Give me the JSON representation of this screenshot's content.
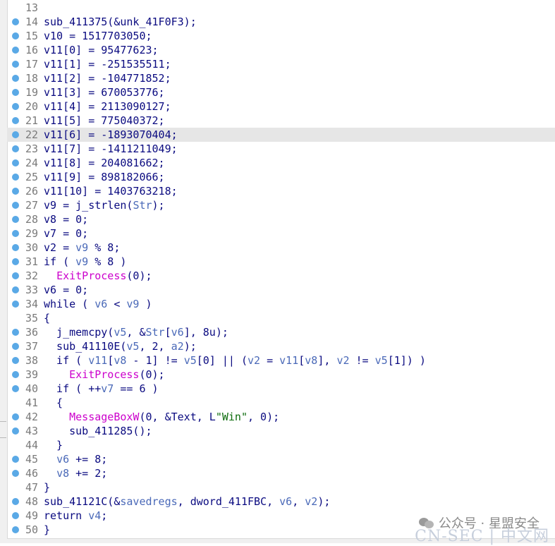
{
  "watermark": {
    "text": "公众号 · 星盟安全",
    "site": "CN-SEC | 中文网"
  },
  "highlighted_line": "22",
  "lines": [
    {
      "num": "13",
      "bp": false,
      "tokens": []
    },
    {
      "num": "14",
      "bp": true,
      "tokens": [
        {
          "t": "sub_411375(&unk_41F0F3);",
          "c": "kw"
        }
      ]
    },
    {
      "num": "15",
      "bp": true,
      "tokens": [
        {
          "t": "v10 = 1517703050;",
          "c": "kw"
        }
      ]
    },
    {
      "num": "16",
      "bp": true,
      "tokens": [
        {
          "t": "v11[0] = 95477623;",
          "c": "kw"
        }
      ]
    },
    {
      "num": "17",
      "bp": true,
      "tokens": [
        {
          "t": "v11[1] = -251535511;",
          "c": "kw"
        }
      ]
    },
    {
      "num": "18",
      "bp": true,
      "tokens": [
        {
          "t": "v11[2] = -104771852;",
          "c": "kw"
        }
      ]
    },
    {
      "num": "19",
      "bp": true,
      "tokens": [
        {
          "t": "v11[3] = 670053776;",
          "c": "kw"
        }
      ]
    },
    {
      "num": "20",
      "bp": true,
      "tokens": [
        {
          "t": "v11[4] = 2113090127;",
          "c": "kw"
        }
      ]
    },
    {
      "num": "21",
      "bp": true,
      "tokens": [
        {
          "t": "v11[5] = 775040372;",
          "c": "kw"
        }
      ]
    },
    {
      "num": "22",
      "bp": true,
      "tokens": [
        {
          "t": "v11[6] = -1893070404;",
          "c": "kw"
        }
      ]
    },
    {
      "num": "23",
      "bp": true,
      "tokens": [
        {
          "t": "v11[7] = -1411211049;",
          "c": "kw"
        }
      ]
    },
    {
      "num": "24",
      "bp": true,
      "tokens": [
        {
          "t": "v11[8] = 204081662;",
          "c": "kw"
        }
      ]
    },
    {
      "num": "25",
      "bp": true,
      "tokens": [
        {
          "t": "v11[9] = 898182066;",
          "c": "kw"
        }
      ]
    },
    {
      "num": "26",
      "bp": true,
      "tokens": [
        {
          "t": "v11[10] = 1403763218;",
          "c": "kw"
        }
      ]
    },
    {
      "num": "27",
      "bp": true,
      "tokens": [
        {
          "t": "v9 = j_strlen(",
          "c": "kw"
        },
        {
          "t": "Str",
          "c": "var"
        },
        {
          "t": ");",
          "c": "kw"
        }
      ]
    },
    {
      "num": "28",
      "bp": true,
      "tokens": [
        {
          "t": "v8 = 0;",
          "c": "kw"
        }
      ]
    },
    {
      "num": "29",
      "bp": true,
      "tokens": [
        {
          "t": "v7 = 0;",
          "c": "kw"
        }
      ]
    },
    {
      "num": "30",
      "bp": true,
      "tokens": [
        {
          "t": "v2 = ",
          "c": "kw"
        },
        {
          "t": "v9",
          "c": "var"
        },
        {
          "t": " % 8;",
          "c": "kw"
        }
      ]
    },
    {
      "num": "31",
      "bp": true,
      "tokens": [
        {
          "t": "if ( ",
          "c": "kw"
        },
        {
          "t": "v9",
          "c": "var"
        },
        {
          "t": " % 8 )",
          "c": "kw"
        }
      ]
    },
    {
      "num": "32",
      "bp": true,
      "tokens": [
        {
          "t": "  ",
          "c": "kw"
        },
        {
          "t": "ExitProcess",
          "c": "fn"
        },
        {
          "t": "(0);",
          "c": "kw"
        }
      ]
    },
    {
      "num": "33",
      "bp": true,
      "tokens": [
        {
          "t": "v6 = 0;",
          "c": "kw"
        }
      ]
    },
    {
      "num": "34",
      "bp": true,
      "tokens": [
        {
          "t": "while ( ",
          "c": "kw"
        },
        {
          "t": "v6",
          "c": "var"
        },
        {
          "t": " < ",
          "c": "kw"
        },
        {
          "t": "v9",
          "c": "var"
        },
        {
          "t": " )",
          "c": "kw"
        }
      ]
    },
    {
      "num": "35",
      "bp": false,
      "tokens": [
        {
          "t": "{",
          "c": "kw"
        }
      ]
    },
    {
      "num": "36",
      "bp": true,
      "tokens": [
        {
          "t": "  j_memcpy(",
          "c": "kw"
        },
        {
          "t": "v5",
          "c": "var"
        },
        {
          "t": ", &",
          "c": "kw"
        },
        {
          "t": "Str",
          "c": "var"
        },
        {
          "t": "[",
          "c": "kw"
        },
        {
          "t": "v6",
          "c": "var"
        },
        {
          "t": "], 8u);",
          "c": "kw"
        }
      ]
    },
    {
      "num": "37",
      "bp": true,
      "tokens": [
        {
          "t": "  sub_41110E(",
          "c": "kw"
        },
        {
          "t": "v5",
          "c": "var"
        },
        {
          "t": ", 2, ",
          "c": "kw"
        },
        {
          "t": "a2",
          "c": "var"
        },
        {
          "t": ");",
          "c": "kw"
        }
      ]
    },
    {
      "num": "38",
      "bp": true,
      "tokens": [
        {
          "t": "  if ( ",
          "c": "kw"
        },
        {
          "t": "v11",
          "c": "var"
        },
        {
          "t": "[",
          "c": "kw"
        },
        {
          "t": "v8",
          "c": "var"
        },
        {
          "t": " - 1] != ",
          "c": "kw"
        },
        {
          "t": "v5",
          "c": "var"
        },
        {
          "t": "[0] || (",
          "c": "kw"
        },
        {
          "t": "v2",
          "c": "var"
        },
        {
          "t": " = ",
          "c": "kw"
        },
        {
          "t": "v11",
          "c": "var"
        },
        {
          "t": "[",
          "c": "kw"
        },
        {
          "t": "v8",
          "c": "var"
        },
        {
          "t": "], ",
          "c": "kw"
        },
        {
          "t": "v2",
          "c": "var"
        },
        {
          "t": " != ",
          "c": "kw"
        },
        {
          "t": "v5",
          "c": "var"
        },
        {
          "t": "[1]) )",
          "c": "kw"
        }
      ]
    },
    {
      "num": "39",
      "bp": true,
      "tokens": [
        {
          "t": "    ",
          "c": "kw"
        },
        {
          "t": "ExitProcess",
          "c": "fn"
        },
        {
          "t": "(0);",
          "c": "kw"
        }
      ]
    },
    {
      "num": "40",
      "bp": true,
      "tokens": [
        {
          "t": "  if ( ++",
          "c": "kw"
        },
        {
          "t": "v7",
          "c": "var"
        },
        {
          "t": " == 6 )",
          "c": "kw"
        }
      ]
    },
    {
      "num": "41",
      "bp": false,
      "tokens": [
        {
          "t": "  {",
          "c": "kw"
        }
      ]
    },
    {
      "num": "42",
      "bp": true,
      "tokens": [
        {
          "t": "    ",
          "c": "kw"
        },
        {
          "t": "MessageBoxW",
          "c": "fn"
        },
        {
          "t": "(0, &Text, L",
          "c": "kw"
        },
        {
          "t": "\"Win\"",
          "c": "str"
        },
        {
          "t": ", 0);",
          "c": "kw"
        }
      ]
    },
    {
      "num": "43",
      "bp": true,
      "tokens": [
        {
          "t": "    sub_411285();",
          "c": "kw"
        }
      ]
    },
    {
      "num": "44",
      "bp": false,
      "tokens": [
        {
          "t": "  }",
          "c": "kw"
        }
      ]
    },
    {
      "num": "45",
      "bp": true,
      "tokens": [
        {
          "t": "  ",
          "c": "kw"
        },
        {
          "t": "v6",
          "c": "var"
        },
        {
          "t": " += 8;",
          "c": "kw"
        }
      ]
    },
    {
      "num": "46",
      "bp": true,
      "tokens": [
        {
          "t": "  ",
          "c": "kw"
        },
        {
          "t": "v8",
          "c": "var"
        },
        {
          "t": " += 2;",
          "c": "kw"
        }
      ]
    },
    {
      "num": "47",
      "bp": false,
      "tokens": [
        {
          "t": "}",
          "c": "kw"
        }
      ]
    },
    {
      "num": "48",
      "bp": true,
      "tokens": [
        {
          "t": "sub_41121C(&",
          "c": "kw"
        },
        {
          "t": "savedregs",
          "c": "var"
        },
        {
          "t": ", dword_411FBC, ",
          "c": "kw"
        },
        {
          "t": "v6",
          "c": "var"
        },
        {
          "t": ", ",
          "c": "kw"
        },
        {
          "t": "v2",
          "c": "var"
        },
        {
          "t": ");",
          "c": "kw"
        }
      ]
    },
    {
      "num": "49",
      "bp": true,
      "tokens": [
        {
          "t": "return ",
          "c": "kw"
        },
        {
          "t": "v4",
          "c": "var"
        },
        {
          "t": ";",
          "c": "kw"
        }
      ]
    },
    {
      "num": "50",
      "bp": true,
      "tokens": [
        {
          "t": "}",
          "c": "kw"
        }
      ]
    }
  ]
}
